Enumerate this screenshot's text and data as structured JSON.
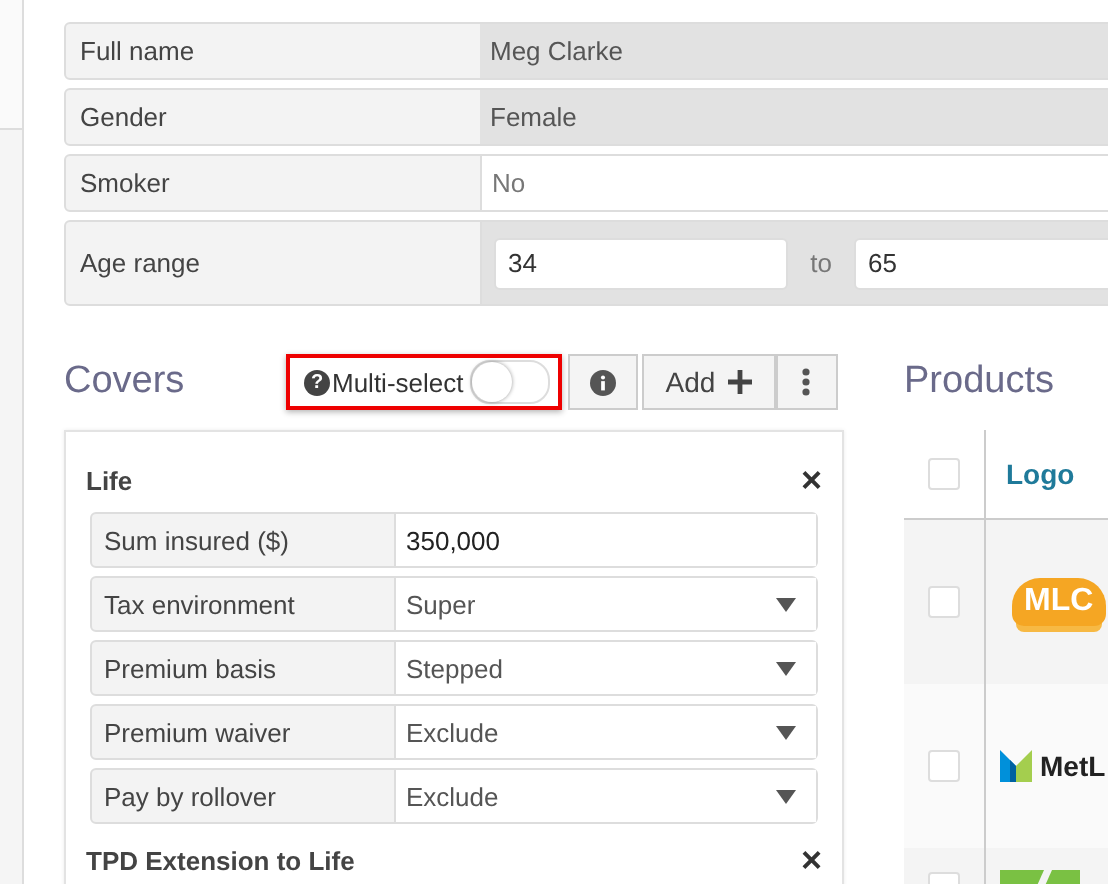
{
  "profile": [
    {
      "label": "Full name",
      "value": "Meg Clarke",
      "kind": "readonly"
    },
    {
      "label": "Gender",
      "value": "Female",
      "kind": "readonly"
    },
    {
      "label": "Smoker",
      "value": "No",
      "kind": "text"
    },
    {
      "label": "Age range",
      "kind": "range",
      "from": "34",
      "joiner": "to",
      "to": "65"
    }
  ],
  "covers": {
    "title": "Covers",
    "help_icon": "?",
    "multi_select": {
      "label": "Multi-select",
      "on": false
    },
    "add_label": "Add",
    "groups": [
      {
        "title": "Life",
        "close": "×",
        "fields": [
          {
            "label": "Sum insured ($)",
            "value": "350,000",
            "kind": "input"
          },
          {
            "label": "Tax environment",
            "value": "Super",
            "kind": "select"
          },
          {
            "label": "Premium basis",
            "value": "Stepped",
            "kind": "select"
          },
          {
            "label": "Premium waiver",
            "value": "Exclude",
            "kind": "select"
          },
          {
            "label": "Pay by rollover",
            "value": "Exclude",
            "kind": "select"
          }
        ]
      },
      {
        "title": "TPD Extension to Life",
        "close": "×"
      }
    ]
  },
  "products": {
    "title": "Products",
    "columns": [
      "Logo"
    ],
    "select_all": {
      "checked": false
    },
    "rows": [
      {
        "checked": false,
        "logo": "MLC",
        "kind": "mlc"
      },
      {
        "checked": false,
        "logo": "MetL",
        "kind": "met"
      },
      {
        "checked": false,
        "kind": "green"
      }
    ]
  }
}
